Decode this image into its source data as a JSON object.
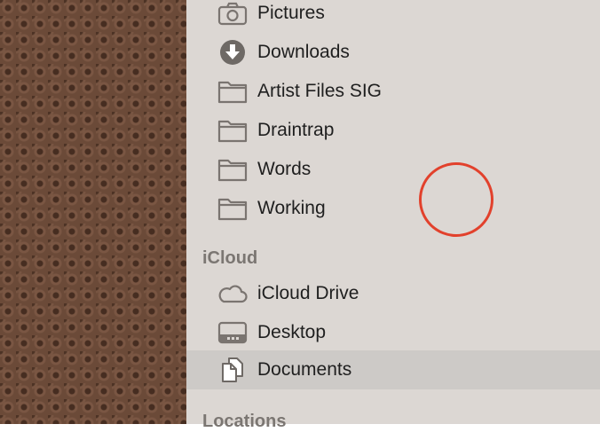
{
  "sidebar": {
    "favorites": [
      {
        "label": "Pictures",
        "icon": "camera-icon"
      },
      {
        "label": "Downloads",
        "icon": "download-icon"
      },
      {
        "label": "Artist Files SIG",
        "icon": "folder-icon"
      },
      {
        "label": "Draintrap",
        "icon": "folder-icon"
      },
      {
        "label": "Words",
        "icon": "folder-icon"
      },
      {
        "label": "Working",
        "icon": "folder-icon"
      }
    ],
    "icloud_header": "iCloud",
    "icloud": [
      {
        "label": "iCloud Drive",
        "icon": "cloud-icon"
      },
      {
        "label": "Desktop",
        "icon": "desktop-icon"
      },
      {
        "label": "Documents",
        "icon": "documents-icon",
        "selected": true
      }
    ],
    "locations_header": "Locations"
  },
  "colors": {
    "sidebar_bg": "#dcd7d3",
    "selected_bg": "#cdcac7",
    "section_header": "#7b7672",
    "cursor_ring": "#e2412c",
    "wallpaper": "#6b4a38"
  }
}
